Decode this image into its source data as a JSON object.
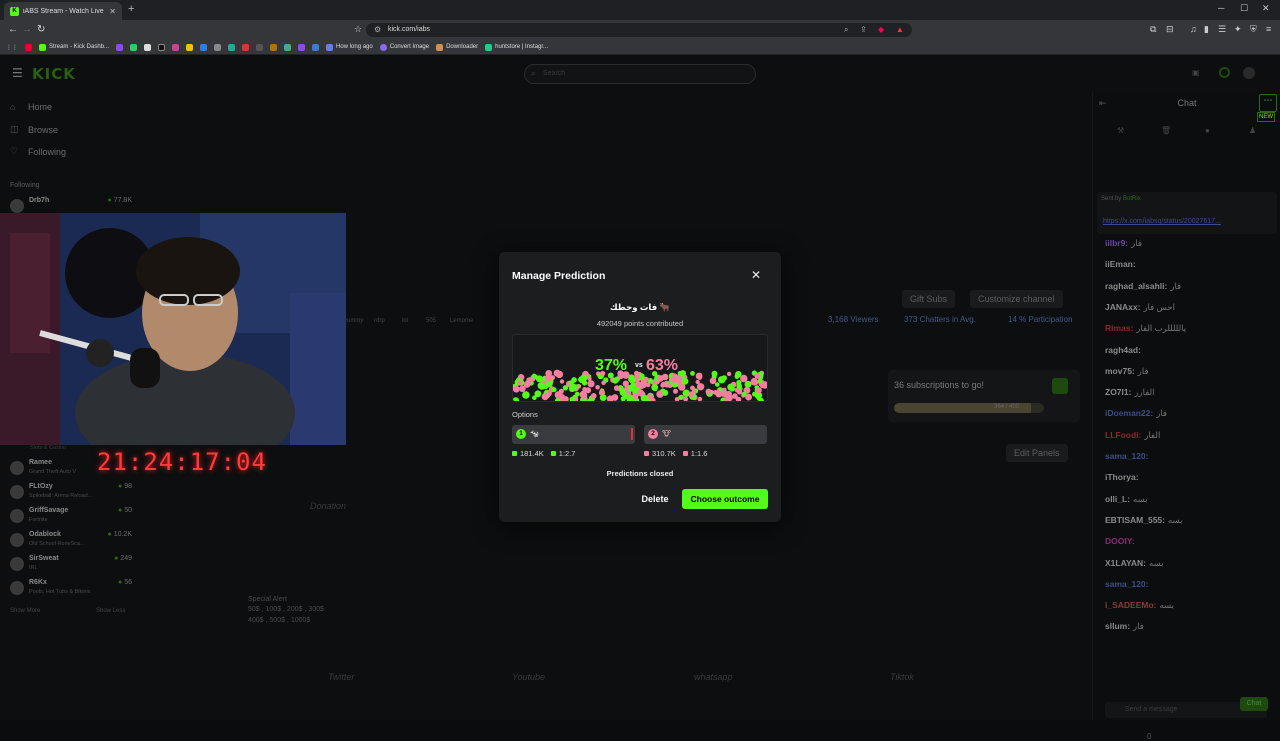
{
  "browser": {
    "tab_title": "iABS Stream - Watch Live on Kick",
    "url": "kick.com/iabs",
    "bookmarks": [
      "Stream - Kick Dashb...",
      "How long ago",
      "Convert Image",
      "Downloader",
      "huntstore | Instagr..."
    ]
  },
  "header": {
    "logo": "KICK",
    "search_placeholder": "Search"
  },
  "sidebar": {
    "nav": [
      {
        "label": "Home"
      },
      {
        "label": "Browse"
      },
      {
        "label": "Following"
      }
    ],
    "following_label": "Following",
    "channels": [
      {
        "name": "Drb7h",
        "game": "",
        "viewers": "77.8K"
      },
      {
        "name": "Ramee",
        "game": "Grand Theft Auto V",
        "viewers": ""
      },
      {
        "name": "FLtOzy",
        "game": "Spikeball: Arena Reload...",
        "viewers": "98"
      },
      {
        "name": "GriffSavage",
        "game": "Fortnite",
        "viewers": "50"
      },
      {
        "name": "Odablock",
        "game": "Old School RuneSca...",
        "viewers": "10.2K"
      },
      {
        "name": "SirSweat",
        "game": "IRL",
        "viewers": "249"
      },
      {
        "name": "R6Kx",
        "game": "Pools, Hot Tubs & Bikinis",
        "viewers": "56"
      }
    ],
    "show_more": "Show More",
    "show_less": "Show Less",
    "slots_label": "Slots & Casino"
  },
  "stream": {
    "timer": "21:24:17:04",
    "viewers": "3,168 Viewers",
    "chatters": "373 Chatters in Avg.",
    "participation": "14 % Participation",
    "gift_subs": "Gift Subs",
    "customize": "Customize channel",
    "edit_panels": "Edit Panels",
    "sub_goal": "36 subscriptions to go!",
    "sub_progress": "364 / 400",
    "sub_fraction": 0.91,
    "tags": [
      "yummy",
      "rdrp",
      "lol",
      "505",
      "Lemome"
    ],
    "special_alert_title": "Special Alert",
    "special_alert_1": "50$ , 100$ , 200$ , 300$",
    "special_alert_2": "400$ , 500$ , 1000$",
    "socials": [
      "Twitter",
      "Youtube",
      "whatsapp",
      "Tiktok"
    ],
    "donation": "Donation"
  },
  "chat": {
    "title": "Chat",
    "pinned_by": "Sent by",
    "pinned_bot": "BotRix",
    "pinned_link": "https://x.com/iabsq/status/20027617...",
    "messages": [
      {
        "user": "iilbr9:",
        "text": "فار",
        "color": "#6a4aa0"
      },
      {
        "user": "iiEman:",
        "text": "",
        "color": "#8a8a8a"
      },
      {
        "user": "raghad_alsahli:",
        "text": "فار",
        "color": "#8a8a8a"
      },
      {
        "user": "JANAxx:",
        "text": "احس فار",
        "color": "#8a8a8a"
      },
      {
        "user": "Rimas:",
        "text": "يالللللرب الفار",
        "color": "#8a2a2a"
      },
      {
        "user": "ragh4ad:",
        "text": "",
        "color": "#8a8a8a"
      },
      {
        "user": "mov75:",
        "text": "فار",
        "color": "#8a8a8a"
      },
      {
        "user": "ZO7l1:",
        "text": "الفارر",
        "color": "#8a8a8a"
      },
      {
        "user": "iDoeman22:",
        "text": "فار",
        "color": "#3a4e8a"
      },
      {
        "user": "LLFoodi:",
        "text": "الفار",
        "color": "#8a2a2a"
      },
      {
        "user": "sama_120:",
        "text": "",
        "color": "#3a4e8a"
      },
      {
        "user": "iThorya:",
        "text": "",
        "color": "#8a8a8a"
      },
      {
        "user": "olli_L:",
        "text": "بسه",
        "color": "#8a8a8a"
      },
      {
        "user": "EBTISAM_555:",
        "text": "بسه",
        "color": "#8a8a8a"
      },
      {
        "user": "DOOIY:",
        "text": "",
        "color": "#8a2a7a"
      },
      {
        "user": "X1LAYAN:",
        "text": "بسه",
        "color": "#8a8a8a"
      },
      {
        "user": "sama_120:",
        "text": "",
        "color": "#3a4e8a"
      },
      {
        "user": "i_SADEEMo:",
        "text": "بسه",
        "color": "#8a3a3a"
      },
      {
        "user": "sllum:",
        "text": "فار",
        "color": "#8a8a8a"
      }
    ],
    "input_placeholder": "Send a message",
    "send_label": "Chat",
    "points": "0"
  },
  "modal": {
    "title": "Manage Prediction",
    "question": "فات وحطك 🐂",
    "contributed": "492049 points contributed",
    "pct_left": "37%",
    "vs": "vs",
    "pct_right": "63%",
    "options_label": "Options",
    "option1": {
      "num": "1",
      "emoji": "🐄",
      "points": "181.4K",
      "ratio": "1:2.7",
      "color": "#53fc18"
    },
    "option2": {
      "num": "2",
      "emoji": "🐮",
      "points": "310.7K",
      "ratio": "1:1.6",
      "color": "#f47ea0"
    },
    "status": "Predictions closed",
    "delete_label": "Delete",
    "outcome_label": "Choose outcome"
  }
}
